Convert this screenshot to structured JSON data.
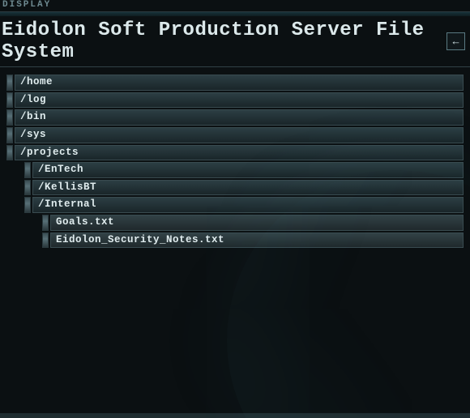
{
  "topbar": {
    "label": "DISPLAY"
  },
  "header": {
    "title": "Eidolon Soft Production Server File System",
    "back_label": "←"
  },
  "tree": {
    "nodes": [
      {
        "label": "/home",
        "depth": 0,
        "type": "dir"
      },
      {
        "label": "/log",
        "depth": 0,
        "type": "dir"
      },
      {
        "label": "/bin",
        "depth": 0,
        "type": "dir"
      },
      {
        "label": "/sys",
        "depth": 0,
        "type": "dir"
      },
      {
        "label": "/projects",
        "depth": 0,
        "type": "dir"
      },
      {
        "label": "/EnTech",
        "depth": 1,
        "type": "dir"
      },
      {
        "label": "/KellisBT",
        "depth": 1,
        "type": "dir"
      },
      {
        "label": "/Internal",
        "depth": 1,
        "type": "dir"
      },
      {
        "label": "Goals.txt",
        "depth": 2,
        "type": "file"
      },
      {
        "label": "Eidolon_Security_Notes.txt",
        "depth": 2,
        "type": "file"
      }
    ]
  }
}
